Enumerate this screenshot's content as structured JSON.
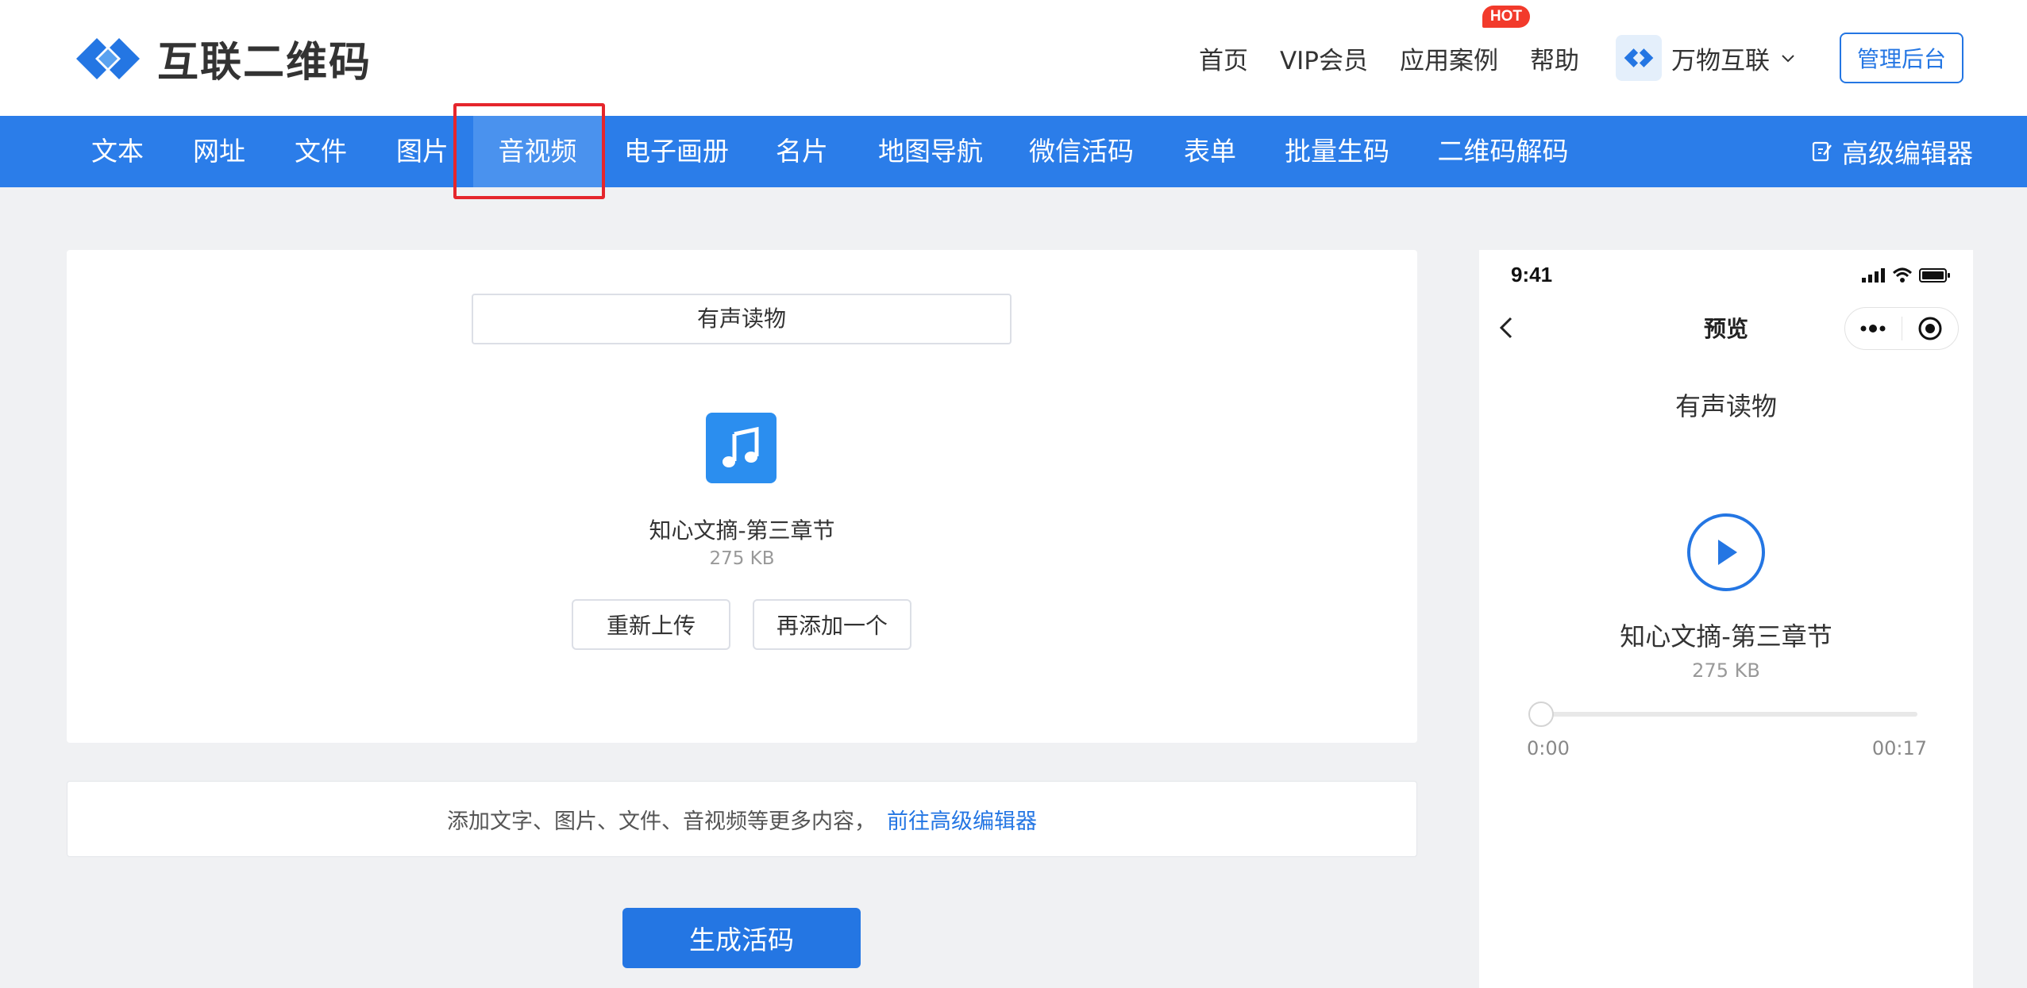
{
  "brand": {
    "name": "互联二维码",
    "accent": "#2476e3"
  },
  "topnav": {
    "links": [
      "首页",
      "VIP会员",
      "应用案例",
      "帮助"
    ],
    "hot_badge": "HOT",
    "account_name": "万物互联",
    "admin_button": "管理后台"
  },
  "mainnav": {
    "tabs": [
      "文本",
      "网址",
      "文件",
      "图片",
      "音视频",
      "电子画册",
      "名片",
      "地图导航",
      "微信活码",
      "表单",
      "批量生码",
      "二维码解码"
    ],
    "active_tab": "音视频",
    "advanced_editor": "高级编辑器"
  },
  "editor": {
    "title_value": "有声读物",
    "file": {
      "name": "知心文摘-第三章节",
      "size": "275 KB",
      "icon": "music-note-icon"
    },
    "reupload_button": "重新上传",
    "add_another_button": "再添加一个",
    "more_content_text": "添加文字、图片、文件、音视频等更多内容，",
    "more_content_link": "前往高级编辑器",
    "generate_button": "生成活码"
  },
  "preview": {
    "status_time": "9:41",
    "header_title": "预览",
    "title": "有声读物",
    "file_name": "知心文摘-第三章节",
    "file_size": "275 KB",
    "time_current": "0:00",
    "time_total": "00:17",
    "progress": 0
  }
}
